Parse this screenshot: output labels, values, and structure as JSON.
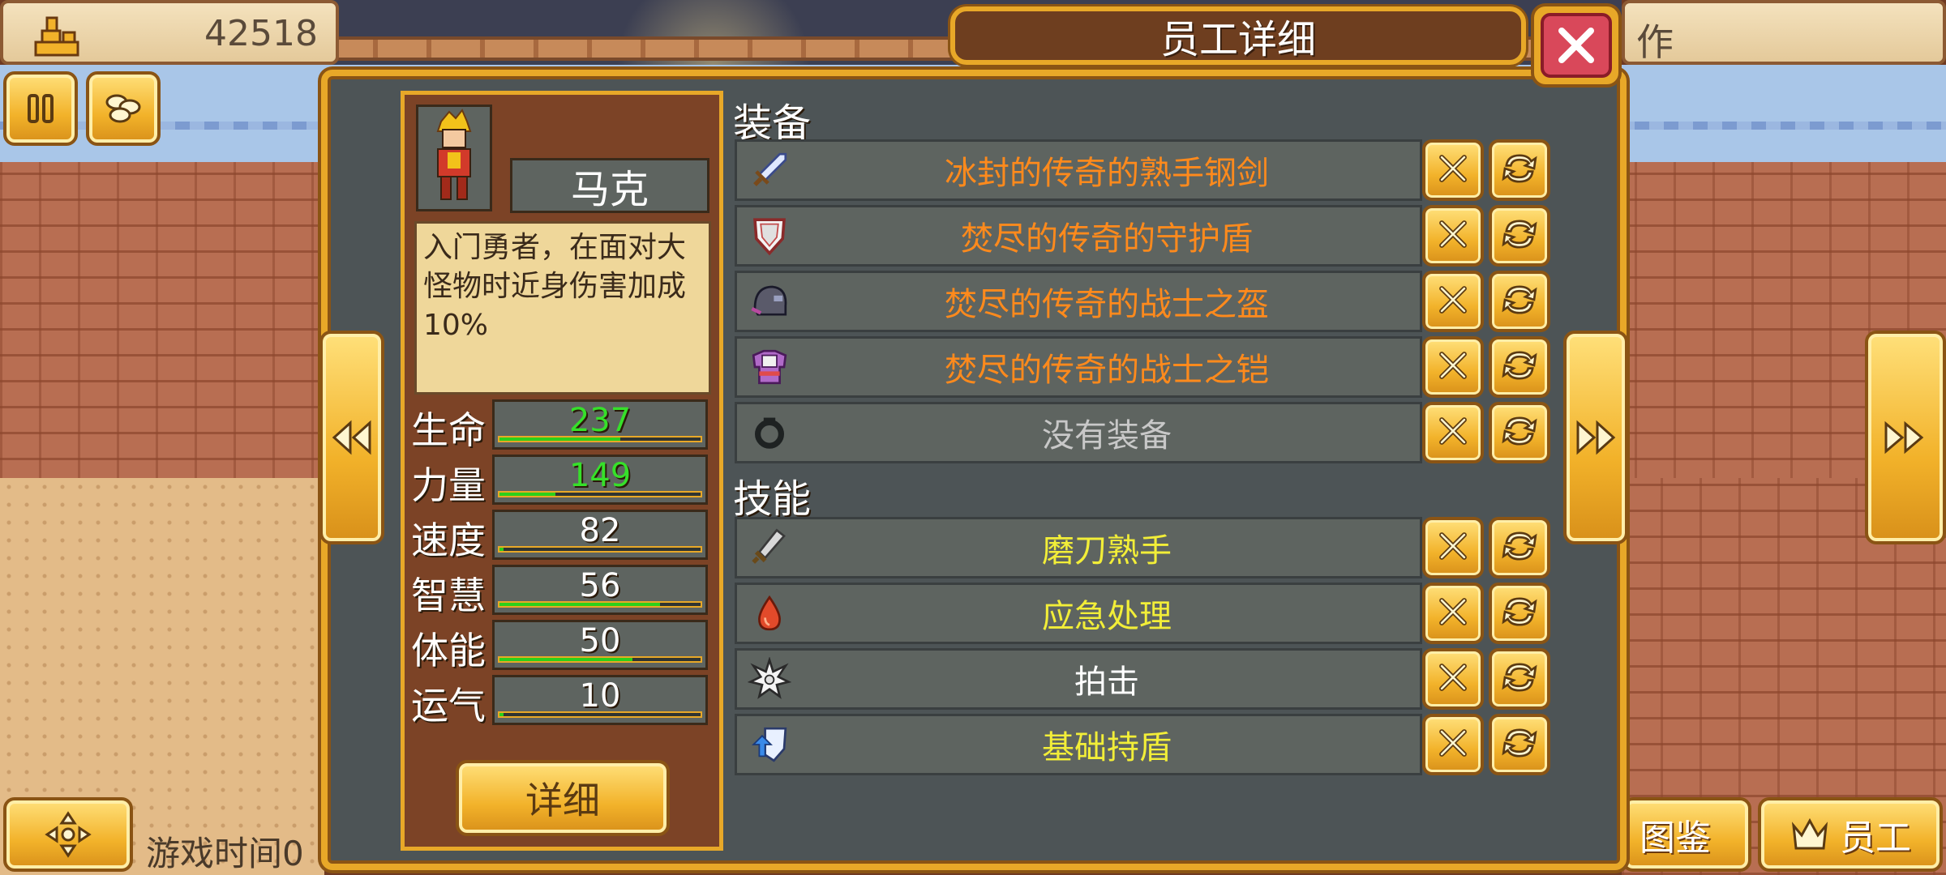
{
  "hud": {
    "money": "42518",
    "right_partial": "作",
    "game_time": "游戏时间0",
    "atlas_label": "图鉴",
    "staff_label": "员工"
  },
  "dialog": {
    "title": "员工详细",
    "employee": {
      "name": "马克",
      "description": "入门勇者，在面对大怪物时近身伤害加成10%",
      "detail_button": "详细"
    },
    "stats": [
      {
        "label": "生命",
        "value": "237",
        "fill": 0.6,
        "highlight": true
      },
      {
        "label": "力量",
        "value": "149",
        "fill": 0.28,
        "highlight": true
      },
      {
        "label": "速度",
        "value": "82",
        "fill": 0.02,
        "highlight": false
      },
      {
        "label": "智慧",
        "value": "56",
        "fill": 0.8,
        "highlight": false
      },
      {
        "label": "体能",
        "value": "50",
        "fill": 0.66,
        "highlight": false
      },
      {
        "label": "运气",
        "value": "10",
        "fill": 0.02,
        "highlight": false
      }
    ],
    "equipment_label": "装备",
    "equipment": [
      {
        "name": "冰封的传奇的熟手钢剑",
        "icon": "sword-icon",
        "color": "orange"
      },
      {
        "name": "焚尽的传奇的守护盾",
        "icon": "shield-icon",
        "color": "orange"
      },
      {
        "name": "焚尽的传奇的战士之盔",
        "icon": "helmet-icon",
        "color": "orange"
      },
      {
        "name": "焚尽的传奇的战士之铠",
        "icon": "armor-icon",
        "color": "orange"
      },
      {
        "name": "没有装备",
        "icon": "ring-slot-icon",
        "color": "grey"
      }
    ],
    "skills_label": "技能",
    "skills": [
      {
        "name": "磨刀熟手",
        "icon": "whetstone-icon",
        "color": "yellow"
      },
      {
        "name": "应急处理",
        "icon": "potion-icon",
        "color": "yellow"
      },
      {
        "name": "拍击",
        "icon": "impact-icon",
        "color": "white"
      },
      {
        "name": "基础持盾",
        "icon": "shield-up-icon",
        "color": "yellow"
      }
    ]
  },
  "colors": {
    "panel": "#4d5456",
    "gold": "#e8a828",
    "legendary": "#ff8a1c",
    "skill": "#f2ee38",
    "stat_green": "#36e02a"
  }
}
